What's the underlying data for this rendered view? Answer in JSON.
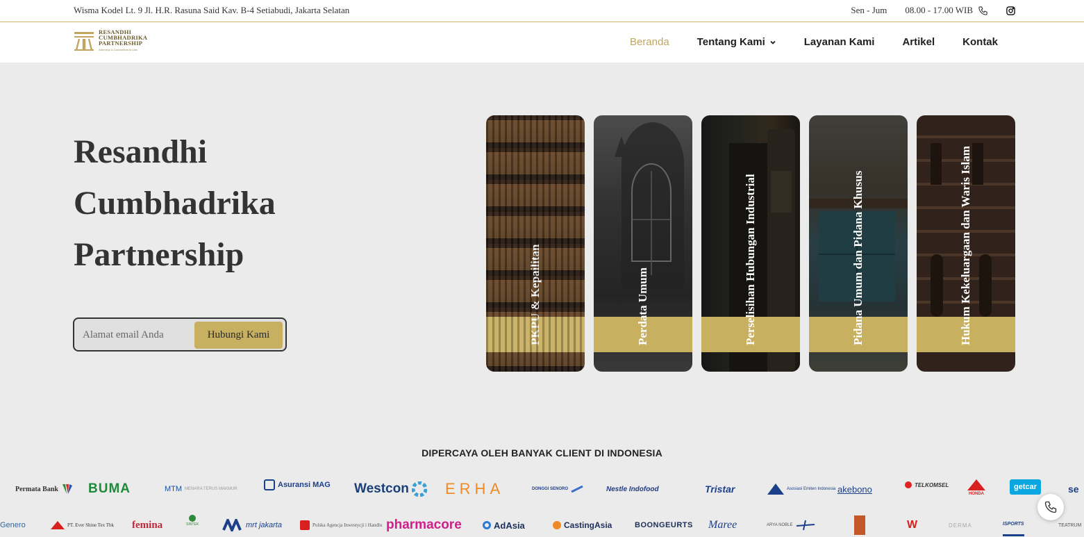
{
  "topbar": {
    "address": "Wisma Kodel Lt. 9 Jl. H.R. Rasuna Said Kav. B-4 Setiabudi, Jakarta Selatan",
    "days": "Sen - Jum",
    "hours": "08.00 - 17.00 WIB",
    "phone_icon": "phone-icon",
    "instagram_icon": "instagram-icon"
  },
  "logo": {
    "line1": "RESANDHI",
    "line2": "CUMBHADRIKA",
    "line3": "PARTNERSHIP",
    "tagline": "Attorneys & Counsellors At Law",
    "color": "#c2a660"
  },
  "nav": {
    "items": [
      {
        "label": "Beranda"
      },
      {
        "label": "Tentang Kami"
      },
      {
        "label": "Layanan Kami"
      },
      {
        "label": "Artikel"
      },
      {
        "label": "Kontak"
      }
    ],
    "active_color": "#c2a660"
  },
  "hero": {
    "title_line1": "Resandhi",
    "title_line2": "Cumbhadrika",
    "title_line3": "Partnership",
    "email_placeholder": "Alamat email Anda",
    "button_label": "Hubungi Kami",
    "accent": "#c8b061"
  },
  "services": [
    {
      "label": "PKPU & Kepailitan"
    },
    {
      "label": "Perdata Umum"
    },
    {
      "label": "Perselisihan Hubungan Industrial"
    },
    {
      "label": "Pidana Umum dan Pidana Khusus"
    },
    {
      "label": "Hukum Kekeluargaan dan Waris Islam"
    }
  ],
  "clients": {
    "title": "DIPERCAYA OLEH BANYAK CLIENT DI INDONESIA",
    "row1": [
      {
        "name": "Permata Bank"
      },
      {
        "name": "BUMA"
      },
      {
        "name": "MTM"
      },
      {
        "name": "Asuransi MAG"
      },
      {
        "name": "Westcon"
      },
      {
        "name": "ERHA"
      },
      {
        "name": "DONGGI SENORO"
      },
      {
        "name": "Nestle Indofood"
      },
      {
        "name": "Tristar"
      },
      {
        "name": "Asosiasi Emiten Indonesia"
      },
      {
        "name": "akebono"
      },
      {
        "name": "TELKOMSEL"
      },
      {
        "name": "HONDA"
      },
      {
        "name": "getcar"
      },
      {
        "name": "se"
      }
    ],
    "row2": [
      {
        "name": "Genero"
      },
      {
        "name": "PT. Ever Shine Tex Tbk"
      },
      {
        "name": "femina"
      },
      {
        "name": "SINTEK"
      },
      {
        "name": "mrt jakarta"
      },
      {
        "name": "Polska Agencja Inwestycji i Handlu"
      },
      {
        "name": "pharmacore"
      },
      {
        "name": "AdAsia"
      },
      {
        "name": "CastingAsia"
      },
      {
        "name": "BOONGEURTS"
      },
      {
        "name": "Maree"
      },
      {
        "name": "ARYA NOBLE"
      },
      {
        "name": "W"
      },
      {
        "name": "DERMA"
      },
      {
        "name": "ISPORTS"
      },
      {
        "name": "TEATRUM"
      }
    ]
  },
  "fab": {
    "icon": "phone-icon"
  }
}
